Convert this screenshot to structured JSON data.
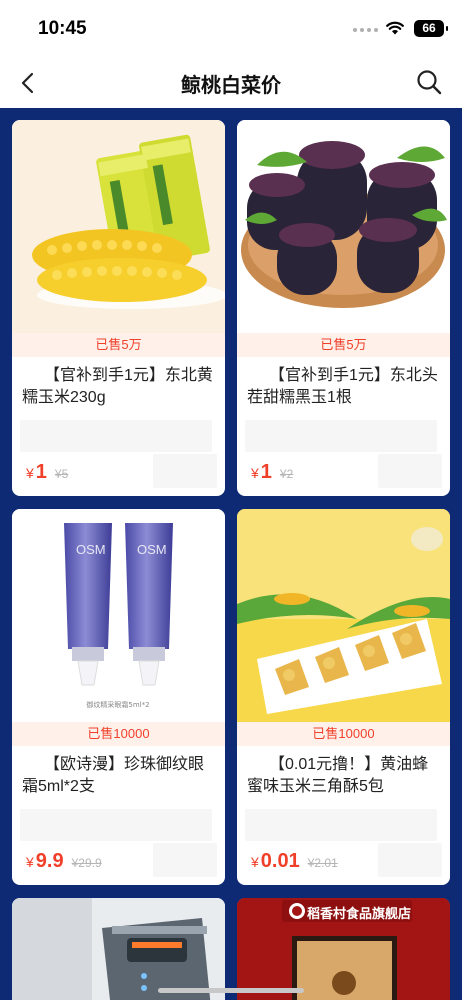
{
  "status": {
    "time": "10:45",
    "battery": "66"
  },
  "nav": {
    "title": "鲸桃白菜价"
  },
  "products": [
    {
      "sold": "已售5万",
      "title": "【官补到手1元】东北黄糯玉米230g",
      "price_symbol": "¥",
      "price": "1",
      "old_price": "¥5",
      "image": "yellow-corn-pack"
    },
    {
      "sold": "已售5万",
      "title": "【官补到手1元】东北头茬甜糯黑玉1根",
      "price_symbol": "¥",
      "price": "1",
      "old_price": "¥2",
      "image": "black-corn-plate"
    },
    {
      "sold": "已售10000",
      "title": "【欧诗漫】珍珠御纹眼霜5ml*2支",
      "price_symbol": "¥",
      "price": "9.9",
      "old_price": "¥29.9",
      "image": "eye-cream-tubes"
    },
    {
      "sold": "已售10000",
      "title": "【0.01元撸！】黄油蜂蜜味玉米三角酥5包",
      "price_symbol": "¥",
      "price": "0.01",
      "old_price": "¥2.01",
      "image": "corn-crisp-plate"
    }
  ],
  "partial_products": [
    {
      "image": "hair-clipper"
    },
    {
      "store_name": "稻香村食品旗舰店",
      "image": "mooncake-box"
    }
  ],
  "colors": {
    "accent": "#f0402a",
    "background": "#0f2a74",
    "sold_bg": "#fff1ea"
  },
  "product_images": {
    "tube_label": "OSM",
    "tube_caption": "御纹精采眼霜5ml*2"
  }
}
